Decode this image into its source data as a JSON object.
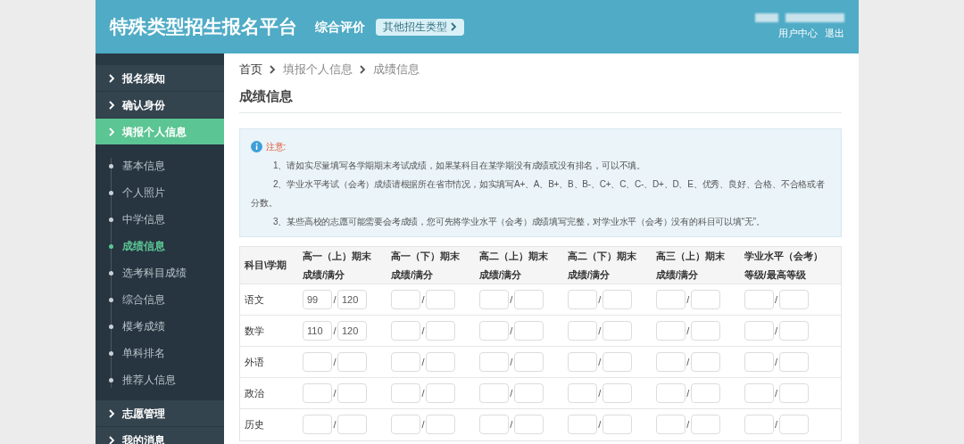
{
  "header": {
    "title": "特殊类型招生报名平台",
    "subtitle": "综合评价",
    "switch_button": "其他招生类型",
    "links": [
      "用户中心",
      "退出"
    ]
  },
  "sidebar": {
    "items": [
      {
        "label": "报名须知",
        "selected": false
      },
      {
        "label": "确认身份",
        "selected": false
      },
      {
        "label": "填报个人信息",
        "selected": true,
        "children": [
          {
            "label": "基本信息",
            "selected": false
          },
          {
            "label": "个人照片",
            "selected": false
          },
          {
            "label": "中学信息",
            "selected": false
          },
          {
            "label": "成绩信息",
            "selected": true
          },
          {
            "label": "选考科目成绩",
            "selected": false
          },
          {
            "label": "综合信息",
            "selected": false
          },
          {
            "label": "模考成绩",
            "selected": false
          },
          {
            "label": "单科排名",
            "selected": false
          },
          {
            "label": "推荐人信息",
            "selected": false
          }
        ]
      },
      {
        "label": "志愿管理",
        "selected": false
      },
      {
        "label": "我的消息",
        "selected": false
      }
    ]
  },
  "breadcrumb": [
    "首页",
    "填报个人信息",
    "成绩信息"
  ],
  "page_title": "成绩信息",
  "notice": {
    "title": "注意:",
    "items": [
      "1、请如实尽量填写各学期期末考试成绩，如果某科目在某学期没有成绩或没有排名，可以不填。",
      "2、学业水平考试（会考）成绩请根据所在省市情况，如实填写A+、A、B+、B、B-、C+、C、C-、D+、D、E、优秀、良好、合格、不合格或者分数。",
      "3、某些高校的志愿可能需要会考成绩，您可先将学业水平（会考）成绩填写完整，对学业水平（会考）没有的科目可以填“无”。"
    ]
  },
  "table": {
    "header_rows": [
      [
        {
          "text": "科目\\学期",
          "rowspan": 2
        },
        {
          "text": "高一（上）期末"
        },
        {
          "text": "高一（下）期末"
        },
        {
          "text": "高二（上）期末"
        },
        {
          "text": "高二（下）期末"
        },
        {
          "text": "高三（上）期末"
        },
        {
          "text": "学业水平（会考）"
        }
      ],
      [
        {
          "text": "成绩/满分"
        },
        {
          "text": "成绩/满分"
        },
        {
          "text": "成绩/满分"
        },
        {
          "text": "成绩/满分"
        },
        {
          "text": "成绩/满分"
        },
        {
          "text": "等级/最高等级"
        }
      ]
    ],
    "rows": [
      {
        "subject": "语文",
        "cells": [
          {
            "score": "99",
            "full": "120"
          },
          {},
          {},
          {},
          {},
          {}
        ]
      },
      {
        "subject": "数学",
        "cells": [
          {
            "score": "110",
            "full": "120"
          },
          {},
          {},
          {},
          {},
          {}
        ]
      },
      {
        "subject": "外语",
        "cells": [
          {},
          {},
          {},
          {},
          {},
          {}
        ]
      },
      {
        "subject": "政治",
        "cells": [
          {},
          {},
          {},
          {},
          {},
          {}
        ]
      },
      {
        "subject": "历史",
        "cells": [
          {},
          {},
          {},
          {},
          {},
          {}
        ]
      }
    ],
    "separator": "/"
  }
}
